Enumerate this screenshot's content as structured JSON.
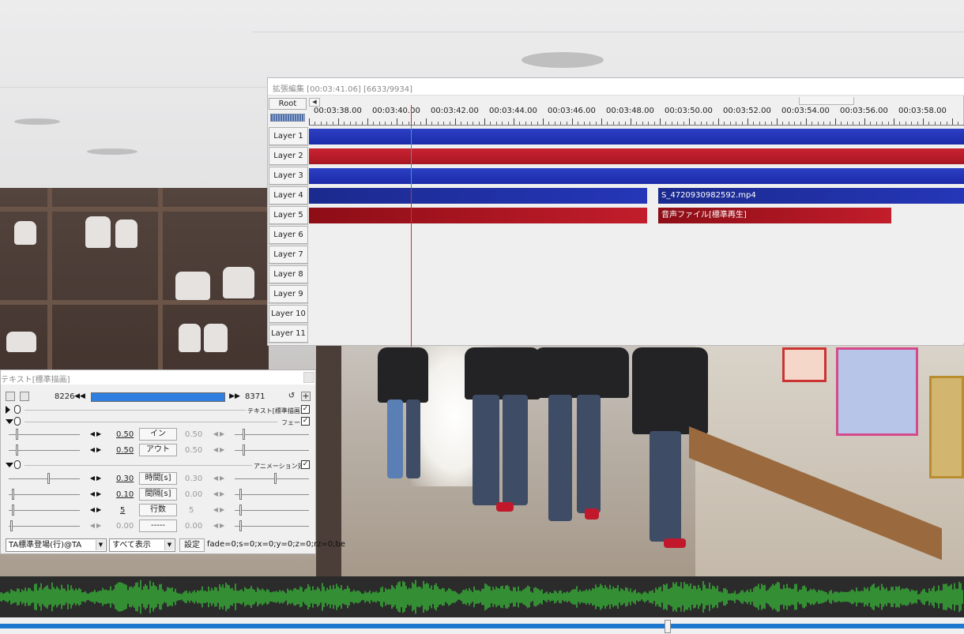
{
  "timeline": {
    "title": "拡張編集 [00:03:41.06] [6633/9934]",
    "root_label": "Root",
    "left_arrow": "◀",
    "ruler_ticks": [
      "00:03:38.00",
      "00:03:40.00",
      "00:03:42.00",
      "00:03:44.00",
      "00:03:46.00",
      "00:03:48.00",
      "00:03:50.00",
      "00:03:52.00",
      "00:03:54.00",
      "00:03:56.00",
      "00:03:58.00"
    ],
    "layers": [
      {
        "label": "Layer 1"
      },
      {
        "label": "Layer 2"
      },
      {
        "label": "Layer 3"
      },
      {
        "label": "Layer 4"
      },
      {
        "label": "Layer 5"
      },
      {
        "label": "Layer 6"
      },
      {
        "label": "Layer 7"
      },
      {
        "label": "Layer 8"
      },
      {
        "label": "Layer 9"
      },
      {
        "label": "Layer 10"
      },
      {
        "label": "Layer 11"
      }
    ],
    "clip_video_name": "S_4720930982592.mp4",
    "clip_audio_name": "音声ファイル[標準再生]",
    "colors": {
      "video": "#1f2fb0",
      "audio": "#b81b29",
      "cursor": "#cc3333"
    }
  },
  "text_dialog": {
    "title": "テキスト[標準描画]",
    "frame_start": "8226",
    "frame_end": "8371",
    "nav_prev": "◀◀",
    "nav_next": "▶▶",
    "effects": [
      {
        "name": "テキスト[標準描画]",
        "checked": "✓"
      },
      {
        "name": "フェード",
        "checked": "✓"
      },
      {
        "name": "アニメーション効果",
        "checked": "✓"
      }
    ],
    "params": [
      {
        "left": "0.50",
        "button": "イン",
        "right": "0.50"
      },
      {
        "left": "0.50",
        "button": "アウト",
        "right": "0.50"
      },
      {
        "left": "0.30",
        "button": "時間[s]",
        "right": "0.30"
      },
      {
        "left": "0.10",
        "button": "間隔[s]",
        "right": "0.00"
      },
      {
        "left": "5",
        "button": "行数",
        "right": "5"
      },
      {
        "left": "0.00",
        "button": "-----",
        "right": "0.00"
      }
    ],
    "arrows": "◀▶",
    "preset_select": "TA標準登場(行)@TA",
    "display_select": "すべて表示",
    "dropdown_arrow": "▼",
    "setting_button": "設定",
    "param_text": "fade=0;s=0;x=0;y=0;z=0;rz=0;be"
  },
  "player": {
    "seek_position": 0.689,
    "waveform_color": "#3df03d"
  }
}
